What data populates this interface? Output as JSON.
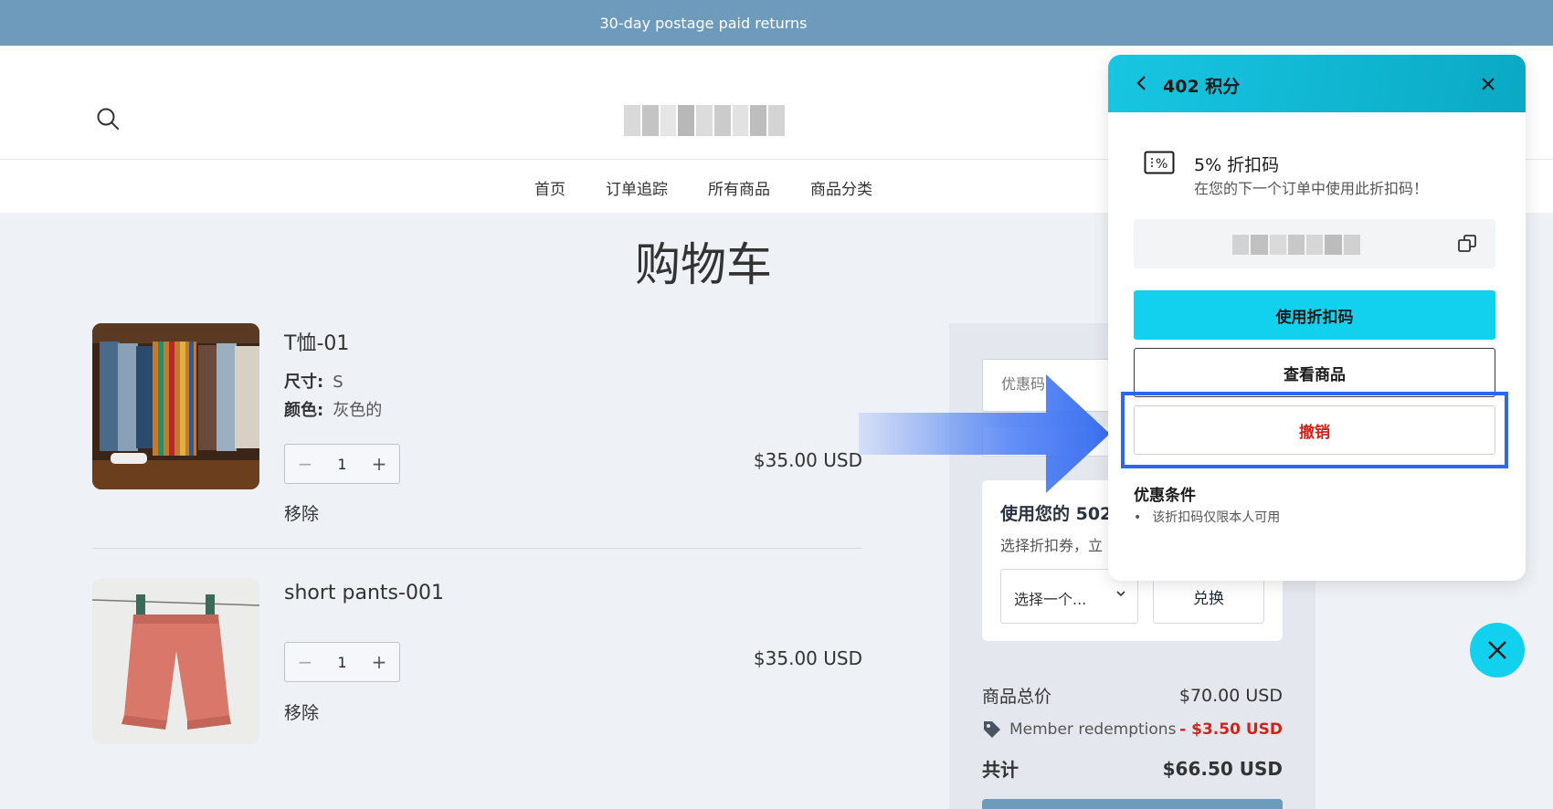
{
  "announcement": "30-day postage paid returns",
  "nav": [
    "首页",
    "订单追踪",
    "所有商品",
    "商品分类"
  ],
  "page_title": "购物车",
  "cart_items": [
    {
      "name": "T恤-01",
      "size_label": "尺寸:",
      "size": "S",
      "color_label": "颜色:",
      "color": "灰色的",
      "quantity": "1",
      "price": "$35.00 USD",
      "remove": "移除"
    },
    {
      "name": "short pants-001",
      "quantity": "1",
      "price": "$35.00 USD",
      "remove": "移除"
    }
  ],
  "summary": {
    "coupon_placeholder": "优惠码",
    "points_title": "使用您的 502",
    "points_desc": "选择折扣券，立",
    "select_placeholder": "选择一个...",
    "redeem_label": "兑换",
    "subtotal_label": "商品总价",
    "subtotal": "$70.00 USD",
    "discount_label": "Member redemptions",
    "discount": "- $3.50 USD",
    "total_label": "共计",
    "total": "$66.50 USD"
  },
  "panel": {
    "title": "402 积分",
    "coupon_title": "5% 折扣码",
    "coupon_sub": "在您的下一个订单中使用此折扣码！",
    "use_label": "使用折扣码",
    "view_label": "查看商品",
    "cancel_label": "撤销",
    "terms_title": "优惠条件",
    "terms": [
      "该折扣码仅限本人可用"
    ]
  },
  "colors": {
    "announcement_bg": "#6e9bbb",
    "accent": "#12d1ee",
    "highlight": "#2f66f0",
    "danger": "#d0241b"
  },
  "icons": [
    "search-icon",
    "back-chevron-icon",
    "close-icon",
    "coupon-percent-icon",
    "copy-icon",
    "tag-icon",
    "chevron-down-icon",
    "arrow-pointer-icon"
  ]
}
